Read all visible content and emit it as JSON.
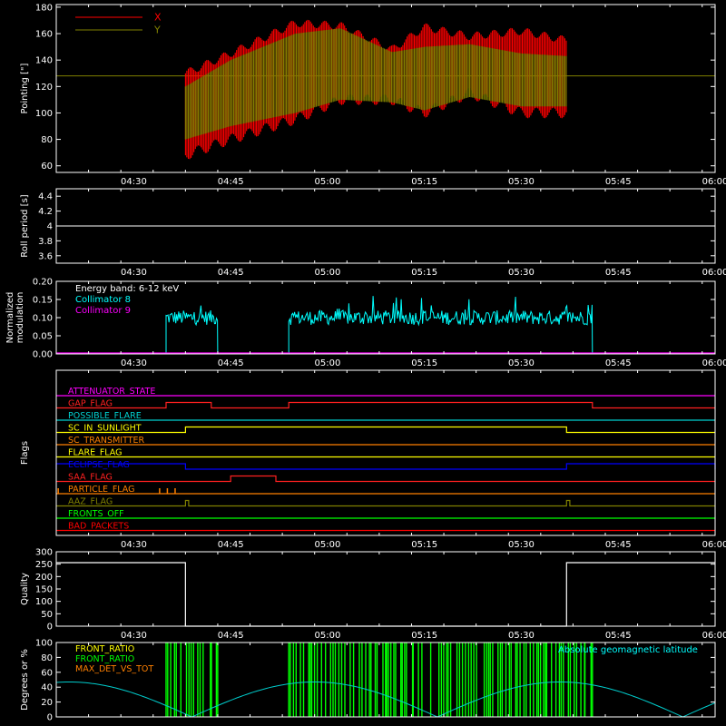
{
  "colors": {
    "background": "#000000",
    "axes": "#ffffff",
    "x_series": "#ff0000",
    "y_series": "#808000",
    "collimator8": "#00ffff",
    "collimator9": "#ff00ff",
    "bars": "#00ff00",
    "latitude": "#00cccc",
    "quality": "#ffffff"
  },
  "x_axis": {
    "range": [
      "04:18",
      "06:00"
    ],
    "tick_labels": [
      "04:30",
      "04:45",
      "05:00",
      "05:15",
      "05:30",
      "05:45",
      "06:00"
    ]
  },
  "chart_data": [
    {
      "id": "pointing",
      "type": "line",
      "ylabel": "Pointing [\"]",
      "ylim": [
        55,
        182
      ],
      "yticks": [
        60,
        80,
        100,
        120,
        140,
        160,
        180
      ],
      "legend": [
        "X",
        "Y"
      ],
      "baseline": 128,
      "data_span": [
        "04:38",
        "05:37"
      ],
      "series": [
        {
          "name": "X",
          "x": [
            "04:38",
            "04:45",
            "04:55",
            "05:02",
            "05:10",
            "05:15",
            "05:22",
            "05:30",
            "05:37"
          ],
          "upper": [
            130,
            145,
            168,
            166,
            148,
            165,
            158,
            162,
            155
          ],
          "lower": [
            68,
            80,
            95,
            110,
            110,
            100,
            115,
            100,
            100
          ]
        },
        {
          "name": "Y",
          "x": [
            "04:38",
            "04:45",
            "04:55",
            "05:02",
            "05:10",
            "05:15",
            "05:22",
            "05:30",
            "05:37"
          ],
          "upper": [
            120,
            140,
            160,
            164,
            146,
            150,
            152,
            145,
            143
          ],
          "lower": [
            80,
            90,
            100,
            110,
            108,
            102,
            112,
            105,
            105
          ]
        }
      ]
    },
    {
      "id": "roll",
      "type": "line",
      "ylabel": "Roll period [s]",
      "ylim": [
        3.5,
        4.5
      ],
      "yticks": [
        3.6,
        3.8,
        4.0,
        4.2,
        4.4
      ],
      "value": 4.0
    },
    {
      "id": "modulation",
      "type": "line",
      "ylabel": "Normalized modulation",
      "ylim": [
        0,
        0.2
      ],
      "yticks": [
        "0.00",
        "0.05",
        "0.10",
        "0.15",
        "0.20"
      ],
      "legend": [
        "Energy band: 6-12 keV",
        "Collimator 8",
        "Collimator 9"
      ],
      "series": [
        {
          "name": "Collimator 8",
          "segments": [
            [
              "04:35",
              "04:43"
            ],
            [
              "04:54",
              "05:41"
            ]
          ],
          "level": 0.1,
          "noise": 0.02,
          "spike_max": 0.16
        },
        {
          "name": "Collimator 9",
          "value": 0.0
        }
      ]
    },
    {
      "id": "flags",
      "type": "line",
      "ylabel": "Flags",
      "rows": [
        {
          "name": "ATTENUATOR_STATE",
          "color": "#ff00ff",
          "steps": []
        },
        {
          "name": "GAP_FLAG",
          "color": "#ff2020",
          "steps": [
            [
              "04:35",
              "04:42"
            ],
            [
              "04:54",
              "05:41"
            ]
          ]
        },
        {
          "name": "POSSIBLE_FLARE",
          "color": "#00d0d0",
          "steps": []
        },
        {
          "name": "SC_IN_SUNLIGHT",
          "color": "#ffff00",
          "steps": [
            [
              "04:38",
              "05:37"
            ]
          ]
        },
        {
          "name": "SC_TRANSMITTER",
          "color": "#ff8000",
          "steps": []
        },
        {
          "name": "FLARE_FLAG",
          "color": "#ffff00",
          "steps": []
        },
        {
          "name": "ECLIPSE_FLAG",
          "color": "#0000ff",
          "steps": [
            [
              "04:18",
              "04:38"
            ],
            [
              "05:37",
              "06:00"
            ]
          ]
        },
        {
          "name": "SAA_FLAG",
          "color": "#ff2020",
          "steps": [
            [
              "04:45",
              "04:52"
            ]
          ]
        },
        {
          "name": "PARTICLE_FLAG",
          "color": "#ff8000",
          "steps": []
        },
        {
          "name": "AAZ_FLAG",
          "color": "#808000",
          "steps": [
            [
              "04:38",
              "04:38.5"
            ],
            [
              "05:37",
              "05:37.5"
            ]
          ]
        },
        {
          "name": "FRONTS_OFF",
          "color": "#00ff00",
          "steps": []
        },
        {
          "name": "BAD_PACKETS",
          "color": "#ff0000",
          "steps": []
        }
      ]
    },
    {
      "id": "quality",
      "type": "line",
      "ylabel": "Quality",
      "ylim": [
        0,
        300
      ],
      "yticks": [
        0,
        50,
        100,
        150,
        200,
        250,
        300
      ],
      "high": 256,
      "segments": [
        [
          "04:18",
          "04:38",
          256
        ],
        [
          "04:38",
          "05:37",
          0
        ],
        [
          "05:37",
          "06:00",
          256
        ]
      ]
    },
    {
      "id": "geomag",
      "type": "bar",
      "ylabel": "Degrees or %",
      "ylim": [
        0,
        100
      ],
      "yticks": [
        0,
        20,
        40,
        60,
        80,
        100
      ],
      "legend": [
        "FRONT_RATIO",
        "FRONT_RATIO",
        "MAX_DET_VS_TOT"
      ],
      "legend_right": "Absolute geomagnetic latitude",
      "bar_segments": [
        [
          "04:35",
          "04:43"
        ],
        [
          "04:54",
          "05:41"
        ]
      ],
      "latitude": {
        "peak": 47,
        "trough": 0,
        "min_times": [
          "04:39",
          "05:17"
        ],
        "max_times": [
          "04:58",
          "05:52"
        ]
      }
    }
  ]
}
